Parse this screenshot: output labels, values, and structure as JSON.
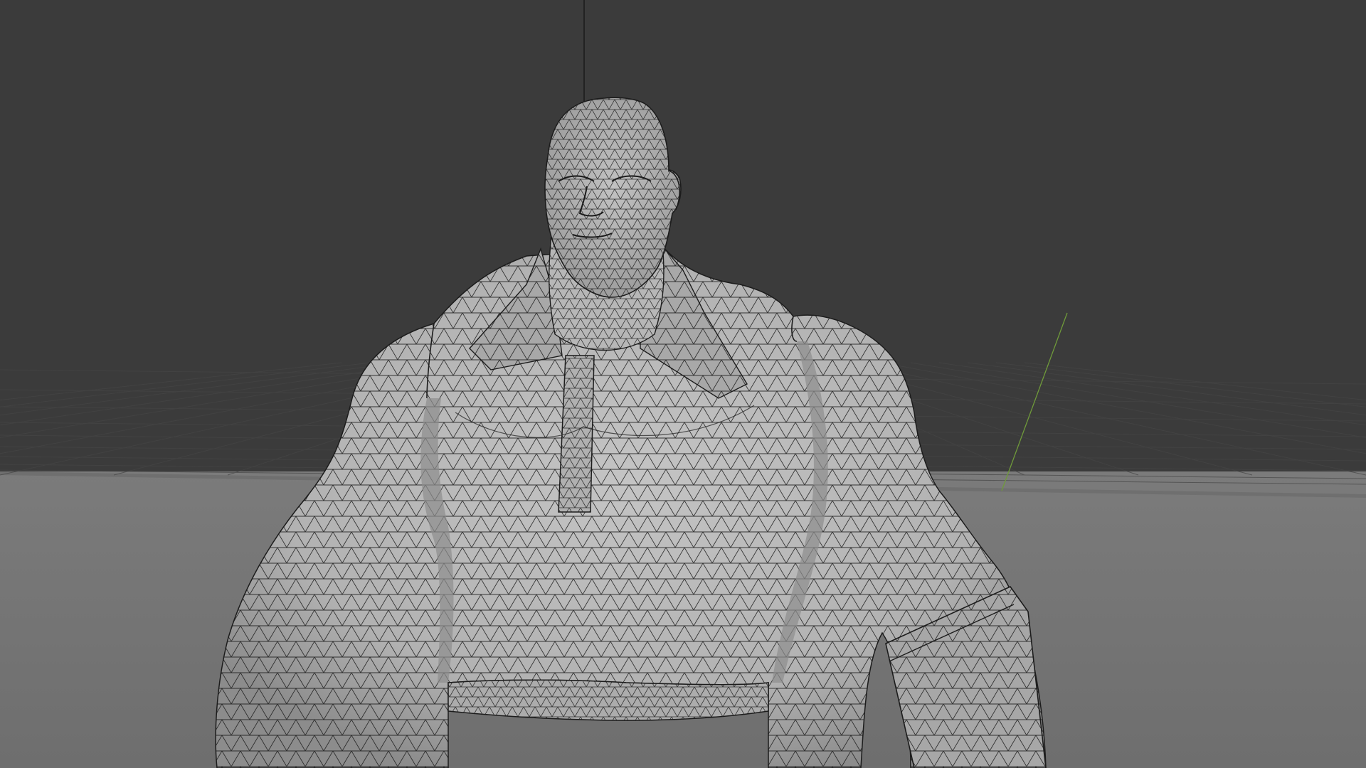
{
  "viewport": {
    "mode": "3d-viewport-wireframe-overlay",
    "object": "character-mesh",
    "show_grid_floor": true,
    "show_y_axis": true,
    "show_z_axis": true
  },
  "colors": {
    "background_top": "#3b3b3b",
    "background_bottom": "#747474",
    "grid_line": "#454545",
    "axis_y": "#6f9a3a",
    "axis_z": "#1a1a1a",
    "mesh_fill": "#b9b9b9",
    "mesh_shade": "#8f8f8f",
    "wire": "#1c1c1c"
  }
}
